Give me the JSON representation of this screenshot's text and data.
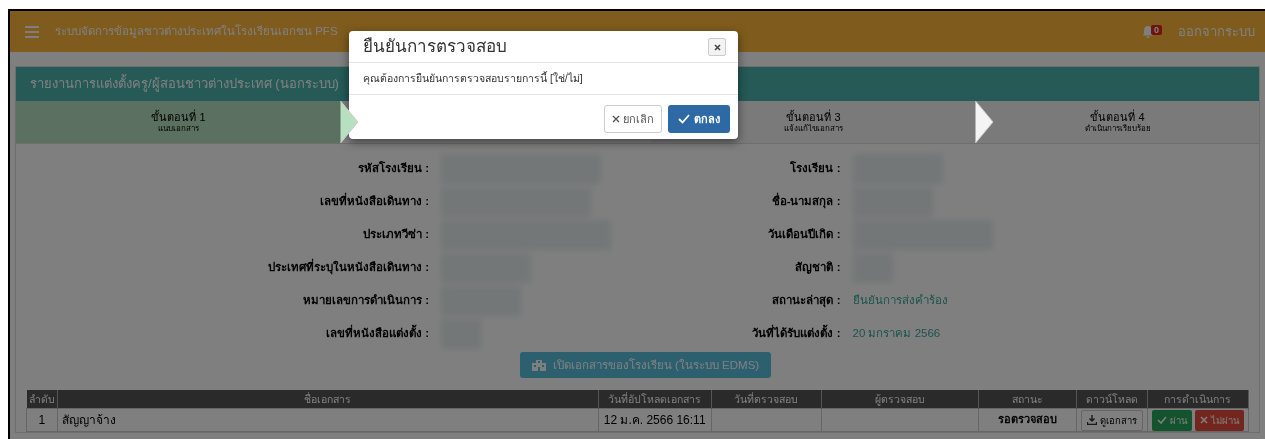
{
  "header": {
    "title": "ระบบจัดการข้อมูลชาวต่างประเทศในโรงเรียนเอกชน PFS",
    "notification_count": "0",
    "logout": "ออกจากระบบ"
  },
  "panel": {
    "title": "รายงานการแต่งตั้งครู/ผู้สอนชาวต่างประเทศ (นอกระบบ)",
    "steps": [
      {
        "title": "ขั้นตอนที่ 1",
        "subtitle": "แนบเอกสาร",
        "selected": true
      },
      {
        "title": "ขั้นตอนที่ 3",
        "subtitle": "แจ้งแก้ไขเอกสาร",
        "selected": false
      },
      {
        "title": "ขั้นตอนที่ 4",
        "subtitle": "ดำเนินการเรียบร้อย",
        "selected": false
      }
    ],
    "fields_left": [
      {
        "label": "รหัสโรงเรียน :",
        "kind": "redacted"
      },
      {
        "label": "เลขที่หนังสือเดินทาง :",
        "kind": "redacted"
      },
      {
        "label": "ประเภทวีซ่า :",
        "kind": "redacted"
      },
      {
        "label": "ประเทศที่ระบุในหนังสือเดินทาง :",
        "kind": "redacted"
      },
      {
        "label": "หมายเลขการดำเนินการ :",
        "kind": "redacted"
      },
      {
        "label": "เลขที่หนังสือแต่งตั้ง :",
        "kind": "redacted"
      }
    ],
    "fields_right": [
      {
        "label": "โรงเรียน :",
        "kind": "redacted"
      },
      {
        "label": "ชื่อ-นามสกุล :",
        "kind": "redacted"
      },
      {
        "label": "วันเดือนปีเกิด :",
        "kind": "redacted"
      },
      {
        "label": "สัญชาติ :",
        "kind": "redacted"
      },
      {
        "label": "สถานะล่าสุด :",
        "kind": "text",
        "value": "ยืนยันการส่งคำร้อง"
      },
      {
        "label": "วันที่ได้รับแต่งตั้ง :",
        "kind": "text",
        "value": "20 มกราคม 2566"
      }
    ],
    "edms_button": "เปิดเอกสารของโรงเรียน (ในระบบ EDMS)"
  },
  "table": {
    "columns": [
      "ลำดับ",
      "ชื่อเอกสาร",
      "วันที่อัปโหลดเอกสาร",
      "วันที่ตรวจสอบ",
      "ผู้ตรวจสอบ",
      "สถานะ",
      "ดาวน์โหลด",
      "การดำเนินการ"
    ],
    "rows": [
      {
        "index": "1",
        "name": "สัญญาจ้าง",
        "uploaded": "12 ม.ค. 2566 16:11",
        "status": "รอตรวจสอบ",
        "download": "ดูเอกสาร",
        "approve": "ผ่าน",
        "reject": "ไม่ผ่าน"
      }
    ]
  },
  "modal": {
    "title": "ยืนยันการตรวจสอบ",
    "message": "คุณต้องการยืนยันการตรวจสอบรายการนี้ [ใช่/ไม่]",
    "cancel": "ยกเลิก",
    "confirm": "ตกลง"
  }
}
